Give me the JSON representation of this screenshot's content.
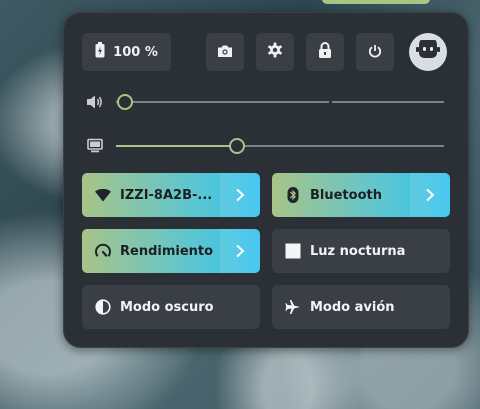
{
  "panel": {
    "battery": {
      "label": "100 %",
      "icon": "battery-full-icon"
    },
    "buttons": [
      {
        "name": "screenshot",
        "icon": "camera-icon"
      },
      {
        "name": "settings",
        "icon": "gear-icon"
      },
      {
        "name": "lock",
        "icon": "lock-icon"
      },
      {
        "name": "power",
        "icon": "power-icon"
      }
    ],
    "avatar": {
      "icon": "robot-avatar-icon"
    },
    "volume": {
      "icon": "speaker-icon",
      "level": 0.0
    },
    "brightness": {
      "icon": "display-icon",
      "level": 0.37
    },
    "toggles": [
      {
        "label": "IZZI-8A2B-...",
        "icon": "wifi-icon",
        "active": true,
        "has_submenu": true
      },
      {
        "label": "Bluetooth",
        "icon": "bluetooth-icon",
        "active": true,
        "has_submenu": true
      },
      {
        "label": "Rendimiento",
        "icon": "speedometer-icon",
        "active": true,
        "has_submenu": true
      },
      {
        "label": "Luz nocturna",
        "icon": "night-light-icon",
        "active": false,
        "has_submenu": false
      },
      {
        "label": "Modo oscuro",
        "icon": "dark-mode-icon",
        "active": false,
        "has_submenu": false
      },
      {
        "label": "Modo avión",
        "icon": "airplane-icon",
        "active": false,
        "has_submenu": false
      }
    ]
  },
  "colors": {
    "accent": "#a8c487",
    "accent_end": "#2fc1ee",
    "panel_bg": "#2b3036",
    "button_bg": "#3a3f46"
  }
}
